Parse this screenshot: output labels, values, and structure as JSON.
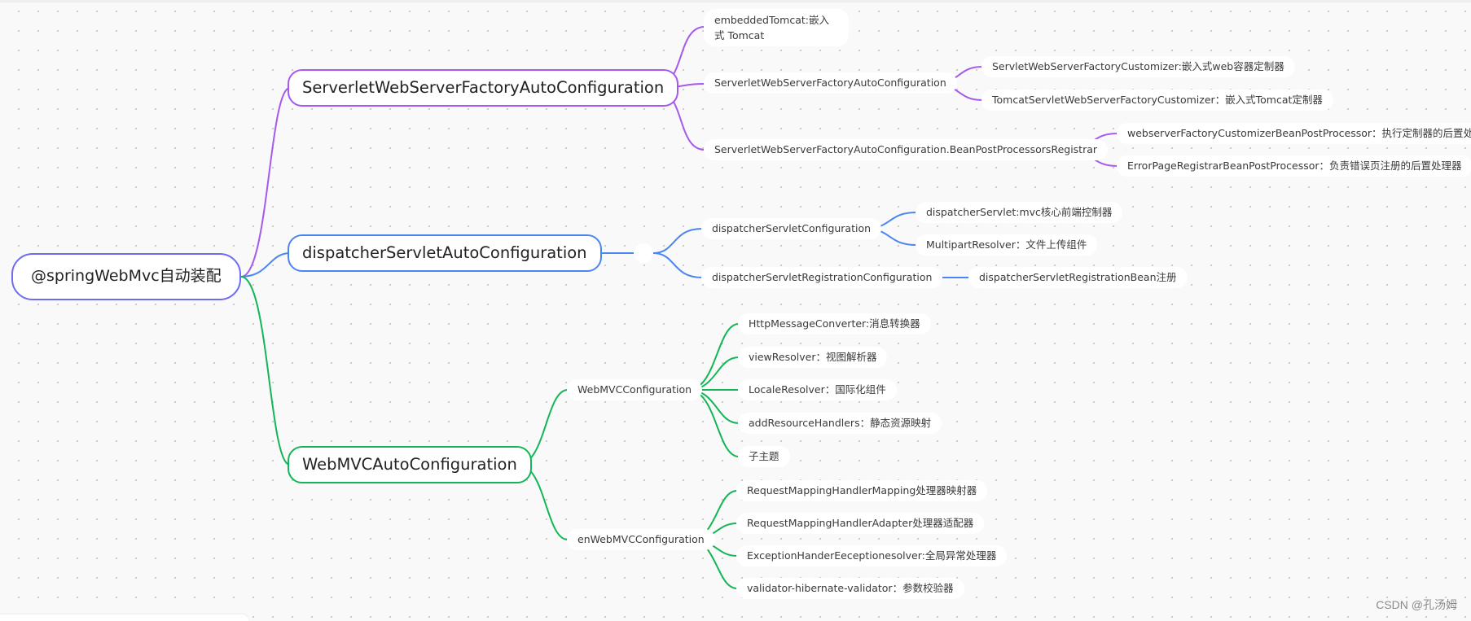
{
  "colors": {
    "root_border": "#6b6df0",
    "branch_purple": "#a659ec",
    "branch_blue": "#4a86f2",
    "branch_green": "#12b656"
  },
  "root": {
    "label": "@springWebMvc自动装配"
  },
  "branches": [
    {
      "label": "ServerletWebServerFactoryAutoConfiguration",
      "color": "purple",
      "children": [
        {
          "label": "embeddedTomcat:嵌入式 Tomcat"
        },
        {
          "label": "ServerletWebServerFactoryAutoConfiguration",
          "children": [
            {
              "label": "ServletWebServerFactoryCustomizer:嵌入式web容器定制器"
            },
            {
              "label": "TomcatServletWebServerFactoryCustomizer：嵌入式Tomcat定制器"
            }
          ]
        },
        {
          "label": "ServerletWebServerFactoryAutoConfiguration.BeanPostProcessorsRegistrar",
          "children": [
            {
              "label": "webserverFactoryCustomizerBeanPostProcessor：执行定制器的后置处理器"
            },
            {
              "label": "ErrorPageRegistrarBeanPostProcessor：负责错误页注册的后置处理器"
            }
          ]
        }
      ]
    },
    {
      "label": "dispatcherServletAutoConfiguration",
      "color": "blue",
      "children": [
        {
          "label": "dispatcherServletConfiguration",
          "children": [
            {
              "label": "dispatcherServlet:mvc核心前端控制器"
            },
            {
              "label": "MultipartResolver：文件上传组件"
            }
          ]
        },
        {
          "label": "dispatcherServletRegistrationConfiguration",
          "children": [
            {
              "label": "dispatcherServletRegistrationBean注册"
            }
          ]
        }
      ]
    },
    {
      "label": "WebMVCAutoConfiguration",
      "color": "green",
      "children": [
        {
          "label": "WebMVCConfiguration",
          "children": [
            {
              "label": "HttpMessageConverter:消息转换器"
            },
            {
              "label": "viewResolver：视图解析器"
            },
            {
              "label": "LocaleResolver：国际化组件"
            },
            {
              "label": "addResourceHandlers：静态资源映射"
            },
            {
              "label": "子主题"
            }
          ]
        },
        {
          "label": "enWebMVCConfiguration",
          "children": [
            {
              "label": "RequestMappingHandlerMapping处理器映射器"
            },
            {
              "label": "RequestMappingHandlerAdapter处理器适配器"
            },
            {
              "label": "ExceptionHanderEeceptionesolver:全局异常处理器"
            },
            {
              "label": "validator-hibernate-validator：参数校验器"
            }
          ]
        }
      ]
    }
  ],
  "watermark": "CSDN @孔汤姆"
}
